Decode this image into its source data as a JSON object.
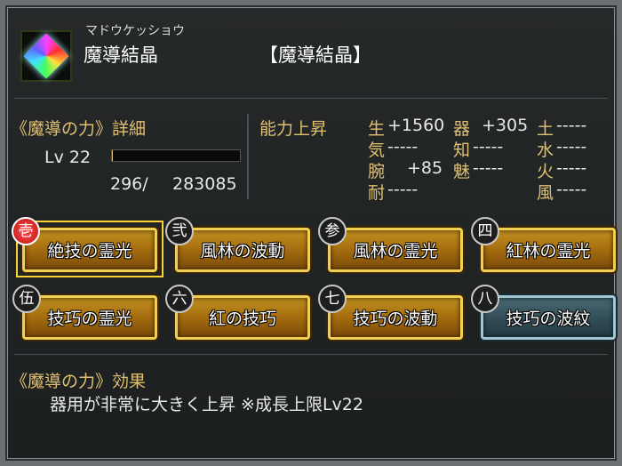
{
  "item": {
    "reading": "マドウケッショウ",
    "name": "魔導結晶",
    "type": "【魔導結晶】",
    "icon": "crystal-icon"
  },
  "power_detail": {
    "title": "《魔導の力》詳細",
    "level_label": "Lv 22",
    "exp_current": "296/",
    "exp_max": "283085",
    "exp_progress": 0.001
  },
  "ability": {
    "title": "能力上昇",
    "stats": [
      {
        "key": "生",
        "value": "+1560"
      },
      {
        "key": "気",
        "value": "-----"
      },
      {
        "key": "腕",
        "value": "+85"
      },
      {
        "key": "耐",
        "value": "-----"
      },
      {
        "key": "器",
        "value": "+305"
      },
      {
        "key": "知",
        "value": "-----"
      },
      {
        "key": "魅",
        "value": "-----"
      },
      {
        "key": "土",
        "value": "-----"
      },
      {
        "key": "水",
        "value": "-----"
      },
      {
        "key": "火",
        "value": "-----"
      },
      {
        "key": "風",
        "value": "-----"
      }
    ]
  },
  "skills": [
    {
      "num": "壱",
      "label": "絶技の霊光",
      "style": "gold",
      "selected": true
    },
    {
      "num": "弐",
      "label": "風林の波動",
      "style": "gold"
    },
    {
      "num": "参",
      "label": "風林の霊光",
      "style": "gold"
    },
    {
      "num": "四",
      "label": "紅林の霊光",
      "style": "gold"
    },
    {
      "num": "伍",
      "label": "技巧の霊光",
      "style": "gold"
    },
    {
      "num": "六",
      "label": "紅の技巧",
      "style": "gold"
    },
    {
      "num": "七",
      "label": "技巧の波動",
      "style": "gold"
    },
    {
      "num": "八",
      "label": "技巧の波紋",
      "style": "blue"
    }
  ],
  "effect": {
    "title": "《魔導の力》効果",
    "text": "器用が非常に大きく上昇 ※成長上限Lv22"
  },
  "colors": {
    "accent_gold": "#e0c070",
    "button_border": "#f0d050"
  }
}
